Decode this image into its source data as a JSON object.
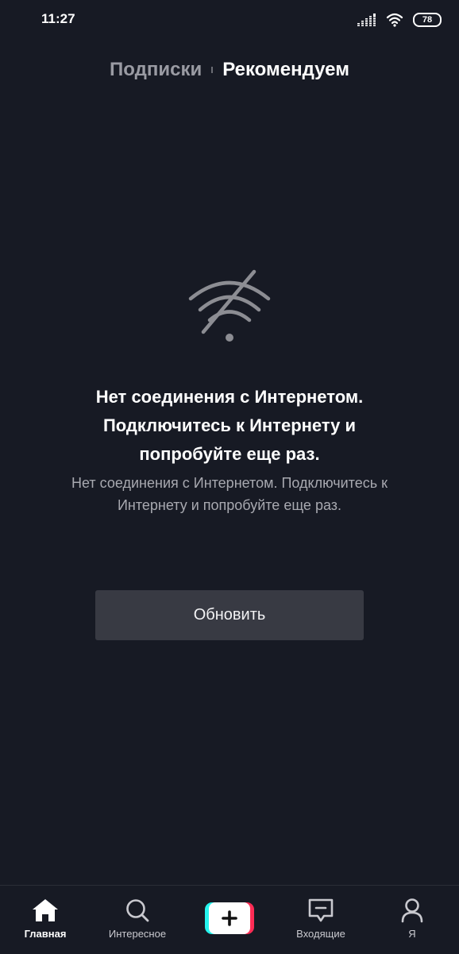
{
  "status_bar": {
    "time": "11:27",
    "battery": "78",
    "icons": [
      "signal-icon",
      "wifi-icon",
      "battery-icon"
    ]
  },
  "top_tabs": {
    "following": "Подписки",
    "for_you": "Рекомендуем",
    "active": "for_you"
  },
  "error": {
    "icon": "no-wifi-icon",
    "title_lines": [
      "Нет соединения с Интернетом.",
      "Подключитесь к Интернету и",
      "попробуйте еще раз."
    ],
    "subtitle_lines": [
      "Нет соединения с Интернетом. Подключитесь к",
      "Интернету и попробуйте еще раз."
    ],
    "refresh_label": "Обновить"
  },
  "bottom_nav": {
    "items": [
      {
        "label": "Главная",
        "icon": "home-icon",
        "active": true
      },
      {
        "label": "Интересное",
        "icon": "search-icon",
        "active": false
      },
      {
        "label": "",
        "icon": "plus-icon",
        "active": false
      },
      {
        "label": "Входящие",
        "icon": "inbox-icon",
        "active": false
      },
      {
        "label": "Я",
        "icon": "profile-icon",
        "active": false
      }
    ]
  },
  "colors": {
    "background": "#171a24",
    "button": "#383a43",
    "create_cyan": "#25f4ee",
    "create_pink": "#fe2c55"
  }
}
